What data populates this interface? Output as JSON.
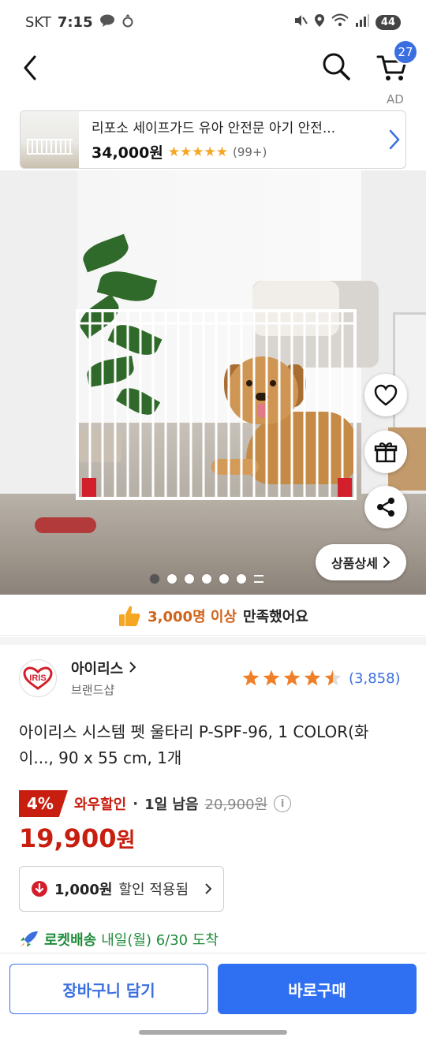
{
  "status_bar": {
    "carrier": "SKT",
    "time": "7:15",
    "battery": "44"
  },
  "header": {
    "cart_count": "27"
  },
  "ad": {
    "label": "AD",
    "title": "리포소 세이프가드 유아 안전문 아기 안전...",
    "price": "34,000원",
    "stars": "★★★★★",
    "review_count": "(99+)"
  },
  "gallery": {
    "detail_label": "상품상세",
    "page_count": 6,
    "active_index": 0
  },
  "satisfaction": {
    "highlight": "3,000명 이상",
    "rest": "만족했어요"
  },
  "brand": {
    "name": "아이리스",
    "sub": "브랜드샵",
    "rating": 4.5,
    "review_count": "(3,858)"
  },
  "product": {
    "title": "아이리스 시스템 펫 울타리 P-SPF-96, 1 COLOR(화이..., 90 x 55 cm, 1개"
  },
  "price": {
    "discount_percent": "4%",
    "wow_label": "와우할인",
    "separator": "·",
    "days_left": "1일 남음",
    "original": "20,900원",
    "sale_number": "19,900",
    "sale_unit": "원"
  },
  "coupon": {
    "amount": "1,000원",
    "text": "할인 적용됨"
  },
  "delivery": {
    "label": "로켓배송",
    "date": "내일(월) 6/30 도착"
  },
  "bottom_bar": {
    "cart_label": "장바구니 담기",
    "buy_label": "바로구매"
  },
  "colors": {
    "accent_blue": "#2f6ff2",
    "sale_red": "#c81e0f",
    "rocket_green": "#1f8c3a",
    "star_orange": "#f5a623"
  }
}
